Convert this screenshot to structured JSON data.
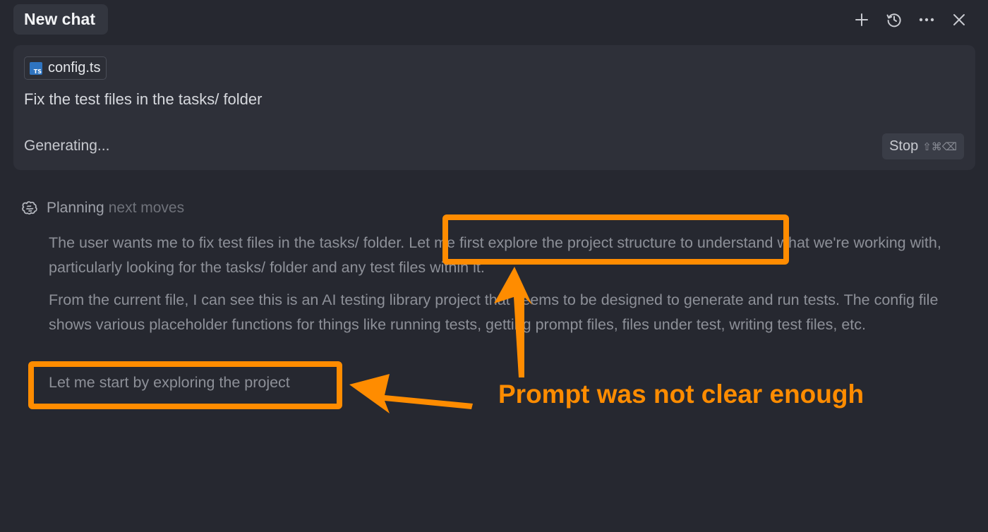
{
  "header": {
    "tab_label": "New chat",
    "icons": [
      "plus-icon",
      "history-icon",
      "more-icon",
      "close-icon"
    ]
  },
  "composer": {
    "file_chip": {
      "icon_text": "TS",
      "label": "config.ts"
    },
    "prompt": "Fix the test files in the tasks/ folder",
    "status": "Generating...",
    "stop_button": {
      "label": "Stop",
      "shortcut": "⇧⌘⌫"
    }
  },
  "thinking": {
    "title_primary": "Planning",
    "title_secondary": "next moves",
    "paragraphs": [
      "The user wants me to fix test files in the tasks/ folder. Let me first explore the project structure to understand what we're working with, particularly looking for the tasks/ folder and any test files within it.",
      "From the current file, I can see this is an AI testing library project that seems to be designed to generate and run tests. The config file shows various placeholder functions for things like running tests, getting prompt files, files under test, writing test files, etc.",
      "Let me start by exploring the project"
    ]
  },
  "annotation": {
    "label": "Prompt was not clear enough",
    "color": "#ff8c00"
  },
  "colors": {
    "background": "#262830",
    "card": "#2e3039",
    "accent": "#ff8c00",
    "ts_blue": "#2f74c0"
  }
}
